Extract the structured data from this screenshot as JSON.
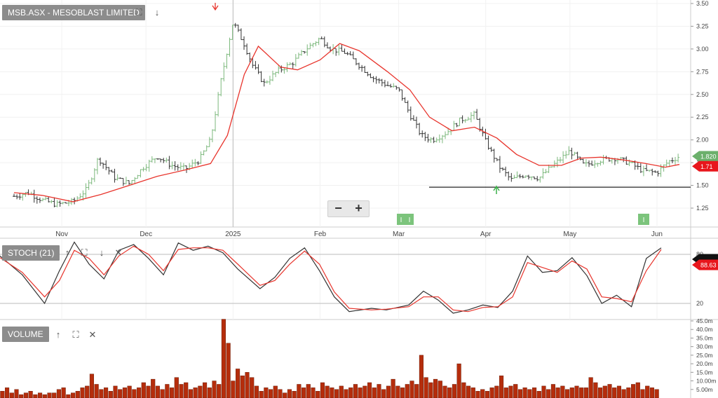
{
  "main_panel": {
    "title": "MSB.ASX - MESOBLAST LIMITED"
  },
  "stoch_panel": {
    "title": "STOCH (21)"
  },
  "volume_panel": {
    "title": "VOLUME"
  },
  "zoom": {
    "minus": "−",
    "plus": "+"
  },
  "colors": {
    "up": "#7cb87c",
    "down": "#333333",
    "ma": "#e8342c",
    "stoch_k": "#333333",
    "stoch_d": "#e8342c",
    "volume": "#b52d0c",
    "last_price_flag": "#6bb06b",
    "ma_flag": "#e8161c"
  },
  "icons": {
    "fullscreen": "expand-icon",
    "down": "arrow-down-icon",
    "up": "arrow-up-icon",
    "close": "close-icon"
  },
  "chart_data": [
    {
      "type": "ohlc",
      "title": "MSB.ASX - MESOBLAST LIMITED",
      "x_ticks": [
        "Nov",
        "Dec",
        "2025",
        "Feb",
        "Mar",
        "Apr",
        "May",
        "Jun"
      ],
      "y_ticks": [
        "3.50",
        "3.25",
        "3.00",
        "2.75",
        "2.50",
        "2.25",
        "2.00",
        "1.75",
        "1.50",
        "1.25"
      ],
      "ylim": [
        1.25,
        3.5
      ],
      "last_price": "1.820",
      "ma_value": "1.71",
      "support_level": 1.48,
      "series": [
        {
          "name": "price",
          "points": [
            [
              "2024-10-15",
              1.38
            ],
            [
              "2024-10-20",
              1.42
            ],
            [
              "2024-10-25",
              1.34
            ],
            [
              "2024-10-30",
              1.29
            ],
            [
              "2024-11-05",
              1.32
            ],
            [
              "2024-11-10",
              1.46
            ],
            [
              "2024-11-14",
              1.8
            ],
            [
              "2024-11-20",
              1.58
            ],
            [
              "2024-11-25",
              1.52
            ],
            [
              "2024-11-30",
              1.7
            ],
            [
              "2024-12-05",
              1.82
            ],
            [
              "2024-12-10",
              1.72
            ],
            [
              "2024-12-15",
              1.68
            ],
            [
              "2024-12-20",
              1.78
            ],
            [
              "2024-12-24",
              2.0
            ],
            [
              "2024-12-28",
              2.7
            ],
            [
              "2025-01-01",
              3.3
            ],
            [
              "2025-01-05",
              3.05
            ],
            [
              "2025-01-08",
              2.82
            ],
            [
              "2025-01-12",
              2.62
            ],
            [
              "2025-01-17",
              2.76
            ],
            [
              "2025-01-22",
              2.84
            ],
            [
              "2025-01-27",
              3.0
            ],
            [
              "2025-02-01",
              3.12
            ],
            [
              "2025-02-05",
              3.0
            ],
            [
              "2025-02-10",
              2.96
            ],
            [
              "2025-02-15",
              2.82
            ],
            [
              "2025-02-20",
              2.68
            ],
            [
              "2025-02-25",
              2.6
            ],
            [
              "2025-03-01",
              2.55
            ],
            [
              "2025-03-05",
              2.28
            ],
            [
              "2025-03-09",
              2.05
            ],
            [
              "2025-03-13",
              2.0
            ],
            [
              "2025-03-18",
              2.08
            ],
            [
              "2025-03-23",
              2.22
            ],
            [
              "2025-03-28",
              2.28
            ],
            [
              "2025-04-01",
              1.98
            ],
            [
              "2025-04-06",
              1.7
            ],
            [
              "2025-04-10",
              1.56
            ],
            [
              "2025-04-15",
              1.62
            ],
            [
              "2025-04-20",
              1.58
            ],
            [
              "2025-04-25",
              1.72
            ],
            [
              "2025-05-01",
              1.88
            ],
            [
              "2025-05-06",
              1.72
            ],
            [
              "2025-05-12",
              1.78
            ],
            [
              "2025-05-17",
              1.8
            ],
            [
              "2025-05-22",
              1.75
            ],
            [
              "2025-05-27",
              1.66
            ],
            [
              "2025-06-01",
              1.64
            ],
            [
              "2025-06-05",
              1.76
            ],
            [
              "2025-06-09",
              1.82
            ]
          ]
        },
        {
          "name": "moving average",
          "points": [
            [
              "2024-10-15",
              1.42
            ],
            [
              "2024-10-25",
              1.39
            ],
            [
              "2024-11-05",
              1.32
            ],
            [
              "2024-11-15",
              1.4
            ],
            [
              "2024-11-25",
              1.5
            ],
            [
              "2024-12-05",
              1.6
            ],
            [
              "2024-12-15",
              1.67
            ],
            [
              "2024-12-24",
              1.74
            ],
            [
              "2024-12-30",
              2.05
            ],
            [
              "2025-01-05",
              2.72
            ],
            [
              "2025-01-10",
              3.03
            ],
            [
              "2025-01-18",
              2.8
            ],
            [
              "2025-01-24",
              2.77
            ],
            [
              "2025-02-01",
              2.88
            ],
            [
              "2025-02-08",
              3.06
            ],
            [
              "2025-02-15",
              2.98
            ],
            [
              "2025-02-25",
              2.75
            ],
            [
              "2025-03-05",
              2.55
            ],
            [
              "2025-03-12",
              2.25
            ],
            [
              "2025-03-20",
              2.1
            ],
            [
              "2025-03-28",
              2.14
            ],
            [
              "2025-04-05",
              2.02
            ],
            [
              "2025-04-12",
              1.84
            ],
            [
              "2025-04-20",
              1.72
            ],
            [
              "2025-04-28",
              1.72
            ],
            [
              "2025-05-05",
              1.8
            ],
            [
              "2025-05-12",
              1.81
            ],
            [
              "2025-05-20",
              1.78
            ],
            [
              "2025-05-28",
              1.74
            ],
            [
              "2025-06-04",
              1.7
            ],
            [
              "2025-06-09",
              1.73
            ]
          ]
        }
      ]
    },
    {
      "type": "line",
      "title": "STOCH (21)",
      "y_ticks": [
        "80",
        "20"
      ],
      "last_values": [
        "88.63"
      ],
      "series": [
        {
          "name": "k",
          "points": [
            [
              0,
              78
            ],
            [
              3,
              55
            ],
            [
              6,
              20
            ],
            [
              8,
              60
            ],
            [
              10,
              95
            ],
            [
              12,
              68
            ],
            [
              14,
              50
            ],
            [
              16,
              85
            ],
            [
              18,
              92
            ],
            [
              20,
              75
            ],
            [
              22,
              55
            ],
            [
              24,
              94
            ],
            [
              26,
              85
            ],
            [
              28,
              90
            ],
            [
              30,
              82
            ],
            [
              32,
              62
            ],
            [
              35,
              38
            ],
            [
              37,
              52
            ],
            [
              39,
              75
            ],
            [
              41,
              88
            ],
            [
              43,
              60
            ],
            [
              45,
              28
            ],
            [
              47,
              10
            ],
            [
              50,
              14
            ],
            [
              52,
              12
            ],
            [
              55,
              18
            ],
            [
              57,
              35
            ],
            [
              59,
              24
            ],
            [
              61,
              8
            ],
            [
              63,
              12
            ],
            [
              65,
              18
            ],
            [
              67,
              15
            ],
            [
              69,
              35
            ],
            [
              71,
              78
            ],
            [
              73,
              58
            ],
            [
              75,
              60
            ],
            [
              77,
              76
            ],
            [
              79,
              54
            ],
            [
              81,
              20
            ],
            [
              83,
              30
            ],
            [
              85,
              16
            ],
            [
              87,
              75
            ],
            [
              89,
              88
            ]
          ]
        },
        {
          "name": "d",
          "points": [
            [
              0,
              76
            ],
            [
              3,
              58
            ],
            [
              6,
              28
            ],
            [
              8,
              48
            ],
            [
              10,
              85
            ],
            [
              12,
              75
            ],
            [
              14,
              55
            ],
            [
              16,
              78
            ],
            [
              18,
              90
            ],
            [
              20,
              80
            ],
            [
              22,
              60
            ],
            [
              24,
              86
            ],
            [
              26,
              88
            ],
            [
              28,
              88
            ],
            [
              30,
              85
            ],
            [
              32,
              68
            ],
            [
              35,
              42
            ],
            [
              37,
              48
            ],
            [
              39,
              68
            ],
            [
              41,
              84
            ],
            [
              43,
              68
            ],
            [
              45,
              34
            ],
            [
              47,
              14
            ],
            [
              50,
              12
            ],
            [
              52,
              13
            ],
            [
              55,
              16
            ],
            [
              57,
              28
            ],
            [
              59,
              28
            ],
            [
              61,
              12
            ],
            [
              63,
              10
            ],
            [
              65,
              15
            ],
            [
              67,
              16
            ],
            [
              69,
              28
            ],
            [
              71,
              70
            ],
            [
              73,
              64
            ],
            [
              75,
              58
            ],
            [
              77,
              72
            ],
            [
              79,
              62
            ],
            [
              81,
              28
            ],
            [
              83,
              26
            ],
            [
              85,
              22
            ],
            [
              87,
              60
            ],
            [
              89,
              86
            ]
          ]
        }
      ]
    },
    {
      "type": "bar",
      "title": "VOLUME",
      "y_ticks": [
        "45.0m",
        "40.0m",
        "35.0m",
        "30.0m",
        "25.0m",
        "20.0m",
        "15.0m",
        "10.00m",
        "5.00m"
      ],
      "ylim": [
        0,
        45
      ],
      "values": [
        4,
        6,
        3,
        5,
        2,
        3,
        4,
        2,
        3,
        2,
        3,
        3,
        5,
        6,
        2,
        3,
        4,
        6,
        7,
        14,
        8,
        5,
        6,
        4,
        7,
        5,
        6,
        7,
        5,
        6,
        9,
        7,
        11,
        7,
        5,
        8,
        6,
        12,
        8,
        9,
        5,
        6,
        7,
        9,
        6,
        10,
        8,
        46,
        32,
        10,
        17,
        13,
        15,
        12,
        7,
        4,
        6,
        5,
        7,
        5,
        3,
        5,
        4,
        8,
        6,
        8,
        6,
        4,
        9,
        7,
        6,
        5,
        7,
        5,
        6,
        8,
        6,
        7,
        9,
        6,
        8,
        5,
        7,
        11,
        7,
        6,
        8,
        10,
        8,
        25,
        12,
        9,
        11,
        10,
        7,
        6,
        8,
        20,
        9,
        7,
        6,
        4,
        5,
        4,
        6,
        7,
        13,
        6,
        7,
        8,
        5,
        6,
        5,
        6,
        4,
        7,
        5,
        8,
        6,
        7,
        5,
        6,
        7,
        6,
        6,
        12,
        9,
        6,
        7,
        8,
        6,
        7,
        5,
        6,
        8,
        9,
        5,
        7,
        6,
        5
      ]
    }
  ]
}
